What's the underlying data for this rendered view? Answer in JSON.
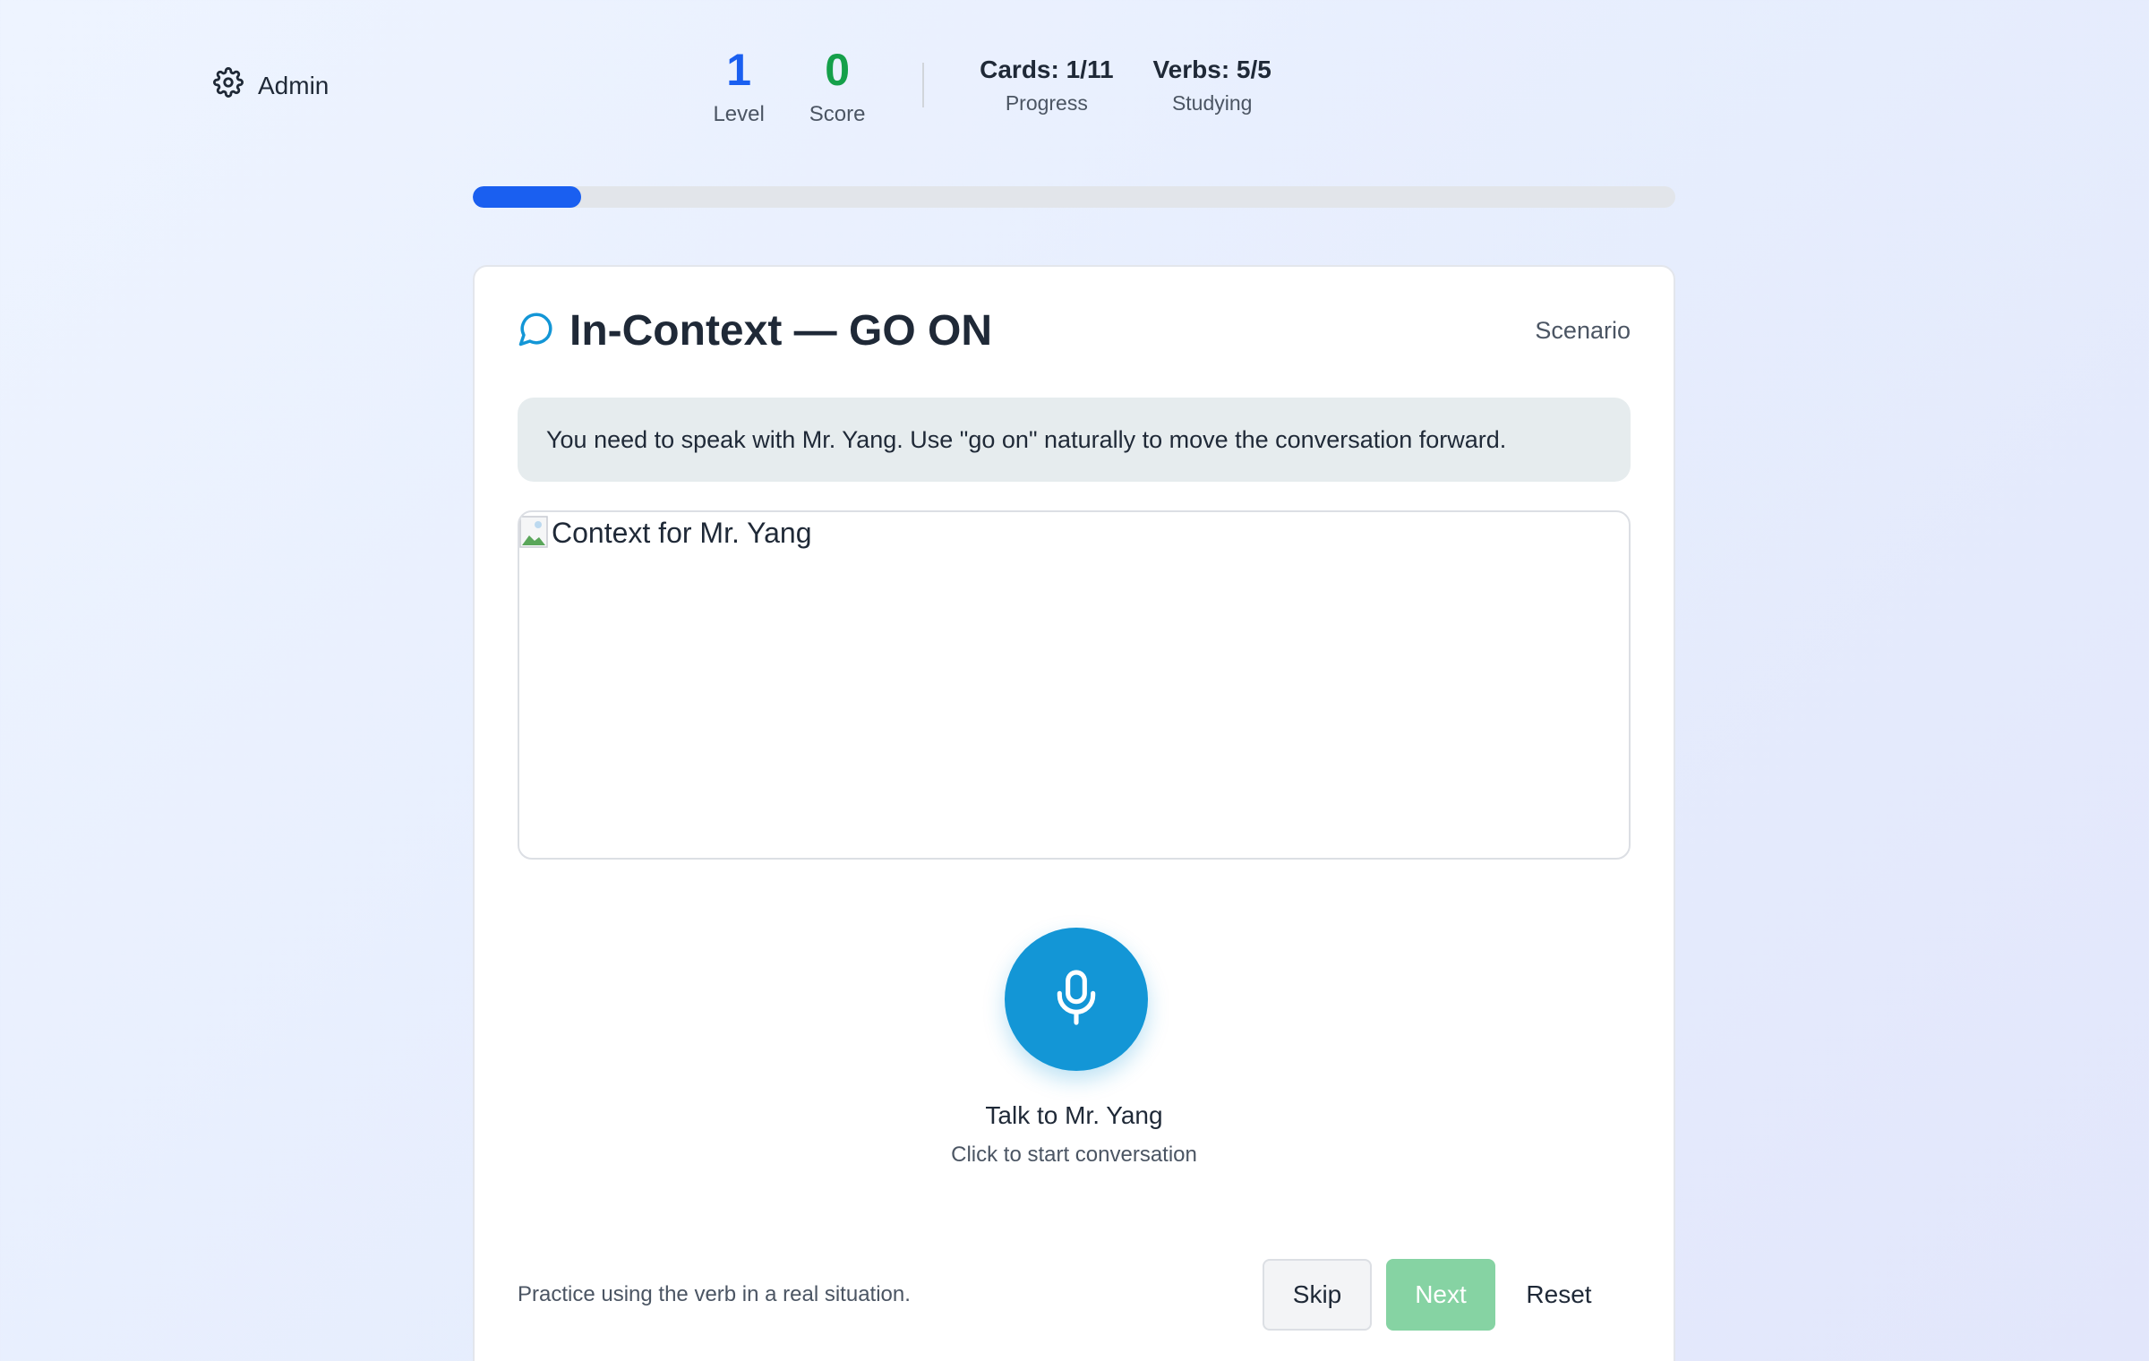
{
  "admin": {
    "label": "Admin",
    "icon": "gear-icon"
  },
  "stats": {
    "level": {
      "value": "1",
      "label": "Level",
      "color": "#1a5ff0"
    },
    "score": {
      "value": "0",
      "label": "Score",
      "color": "#15a04a"
    },
    "cards": {
      "value": "Cards: 1/11",
      "label": "Progress"
    },
    "verbs": {
      "value": "Verbs: 5/5",
      "label": "Studying"
    }
  },
  "progress": {
    "fraction": 0.09,
    "color": "#1a5ff0"
  },
  "card": {
    "icon": "chat-bubble-icon",
    "title": "In-Context — GO ON",
    "tag": "Scenario",
    "scenario_text": "You need to speak with Mr. Yang. Use \"go on\" naturally to move the conversation forward.",
    "image_alt": "Context for Mr. Yang",
    "mic_icon": "microphone-icon",
    "mic_color": "#1396d6",
    "talk_title": "Talk to Mr. Yang",
    "talk_subtitle": "Click to start conversation",
    "footer_hint": "Practice using the verb in a real situation.",
    "buttons": {
      "skip": "Skip",
      "next": "Next",
      "reset": "Reset"
    }
  }
}
